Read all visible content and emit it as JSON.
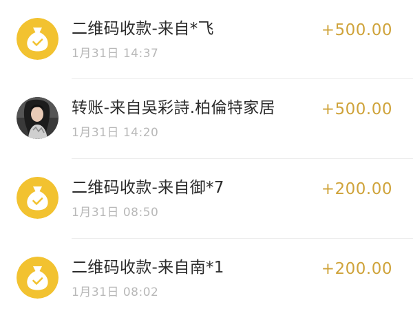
{
  "colors": {
    "amount": "#cfa33a",
    "icon_bg": "#f2c230",
    "title": "#2b2b2b",
    "time": "#b8b8b8",
    "divider": "#ececec"
  },
  "transactions": [
    {
      "icon": "money-bag-icon",
      "title": "二维码收款-来自*飞",
      "time": "1月31日 14:37",
      "amount": "+500.00"
    },
    {
      "icon": "user-avatar",
      "title": "转账-来自吳彩詩.柏倫特家居",
      "time": "1月31日 14:20",
      "amount": "+500.00"
    },
    {
      "icon": "money-bag-icon",
      "title": "二维码收款-来自御*7",
      "time": "1月31日 08:50",
      "amount": "+200.00"
    },
    {
      "icon": "money-bag-icon",
      "title": "二维码收款-来自南*1",
      "time": "1月31日 08:02",
      "amount": "+200.00"
    }
  ]
}
